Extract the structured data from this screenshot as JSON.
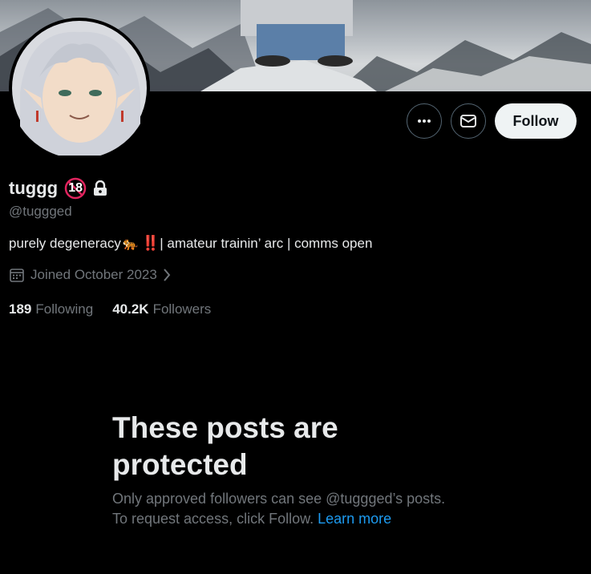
{
  "profile": {
    "display_name": "tuggg",
    "age_badge": "18",
    "handle": "@tuggged",
    "bio": {
      "emoji": "🐅",
      "bangbang": "‼️",
      "text": " | amateur trainin’ arc | comms open",
      "prefix": "purely degeneracy "
    },
    "joined": "Joined October 2023",
    "following": {
      "count": "189",
      "label": "Following"
    },
    "followers": {
      "count": "40.2K",
      "label": "Followers"
    }
  },
  "actions": {
    "follow_label": "Follow"
  },
  "protected": {
    "title_line1": "These posts are",
    "title_line2": "protected",
    "desc_line1": "Only approved followers can see @tuggged’s posts.",
    "desc_line2": "To request access, click Follow. ",
    "learn_more": "Learn more"
  },
  "colors": {
    "background": "#000000",
    "text_primary": "#e7e9ea",
    "text_secondary": "#71767b",
    "link": "#1d9bf0",
    "follow_bg": "#eff3f4",
    "border": "#536471"
  }
}
